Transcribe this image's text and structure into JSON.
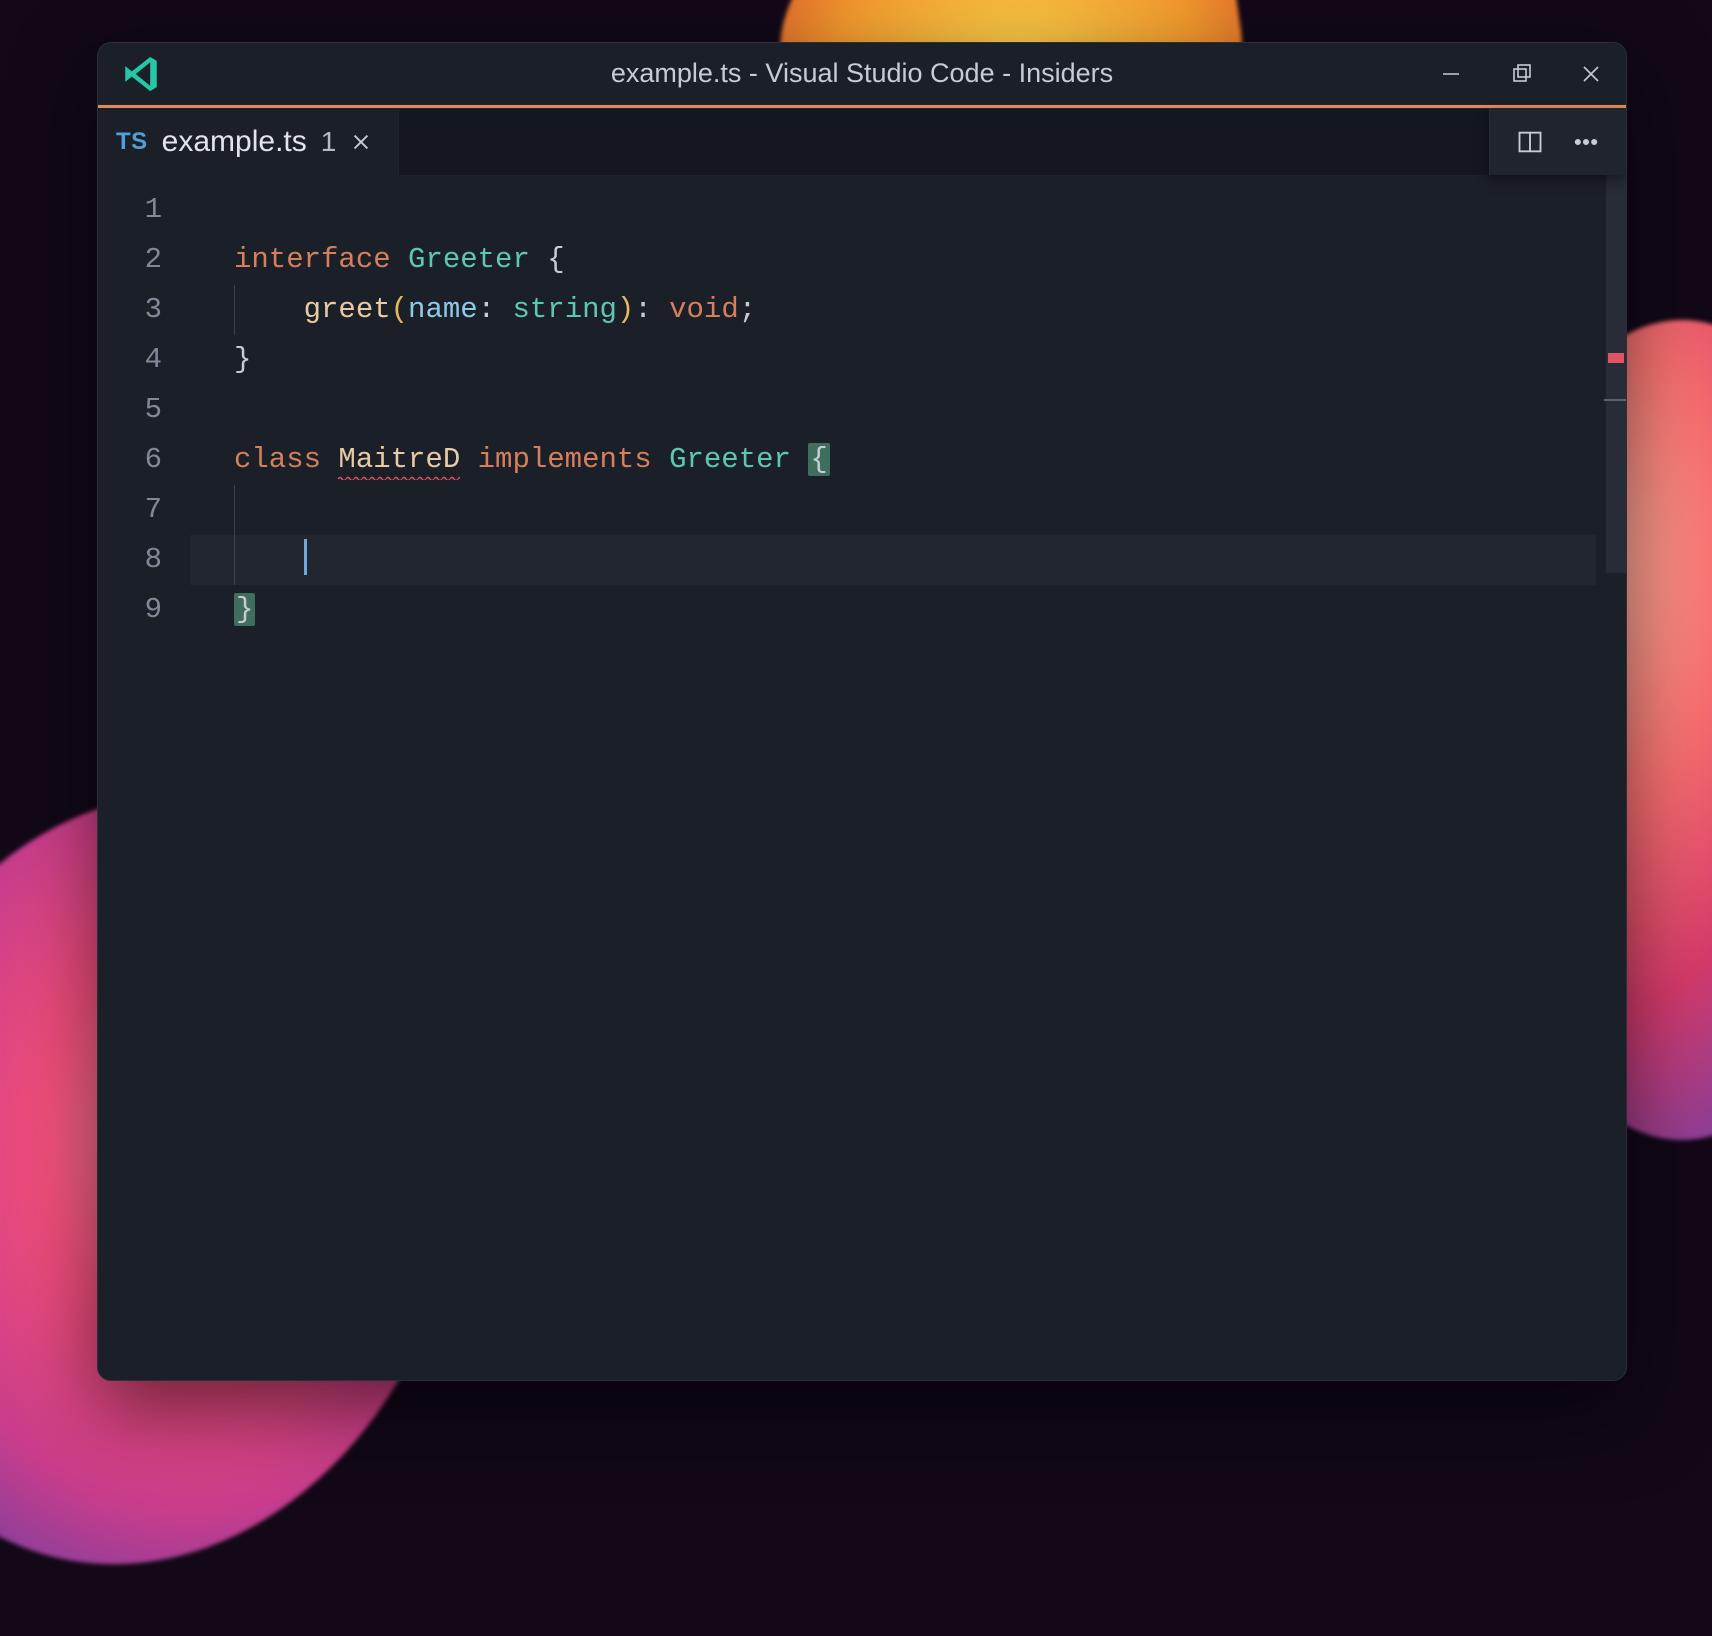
{
  "window": {
    "title": "example.ts - Visual Studio Code - Insiders"
  },
  "tab": {
    "language_badge": "TS",
    "filename": "example.ts",
    "problem_count": "1"
  },
  "editor": {
    "line_numbers": [
      "1",
      "2",
      "3",
      "4",
      "5",
      "6",
      "7",
      "8",
      "9"
    ],
    "ln2": {
      "kw": "interface",
      "type": "Greeter",
      "brace": "{"
    },
    "ln3": {
      "method": "greet",
      "paren_open": "(",
      "param": "name",
      "colon1": ":",
      "ptype": "string",
      "paren_close": ")",
      "colon2": ":",
      "rtype": "void",
      "semi": ";"
    },
    "ln4": {
      "brace": "}"
    },
    "ln6": {
      "kw1": "class",
      "classname": "MaitreD",
      "kw2": "implements",
      "iface": "Greeter",
      "brace": "{"
    },
    "ln9": {
      "brace": "}"
    },
    "current_line": 8
  },
  "colors": {
    "accent": "#e28a57",
    "error": "#e05561"
  }
}
